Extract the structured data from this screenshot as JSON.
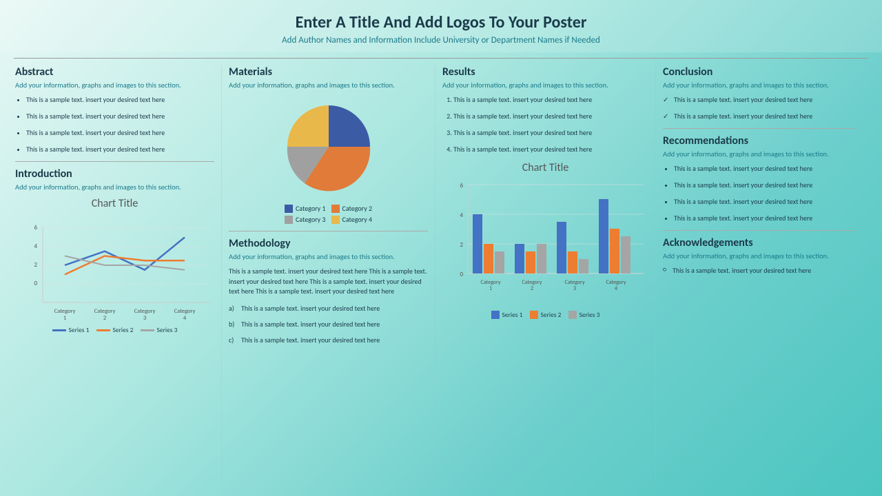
{
  "header": {
    "title": "Enter A Title And Add Logos To Your Poster",
    "subtitle": "Add Author Names and Information Include University or Department Names if Needed"
  },
  "colors": {
    "blue": "#3B5BA5",
    "orange": "#E07B39",
    "gray": "#A0A0A0",
    "yellow": "#E8B84B",
    "teal": "#1a7a8a",
    "dark": "#1a3a4a",
    "series1": "#4472C4",
    "series2": "#ED7D31",
    "series3": "#A5A5A5"
  },
  "abstract": {
    "title": "Abstract",
    "subtitle": "Add your information, graphs and images to this section.",
    "items": [
      "This is a sample text. insert your desired text here",
      "This is a sample text. insert your desired text here",
      "This is a sample text. insert your desired text here",
      "This is a sample text. insert your desired text here"
    ]
  },
  "introduction": {
    "title": "Introduction",
    "subtitle": "Add your information, graphs and images to this section.",
    "chart_title": "Chart Title",
    "categories": [
      "Category 1",
      "Category 2",
      "Category 3",
      "Category 4"
    ],
    "series": [
      "Series 1",
      "Series 2",
      "Series 3"
    ],
    "line_data": {
      "series1": [
        2,
        3.5,
        1.5,
        5
      ],
      "series2": [
        1,
        3,
        2.5,
        2.5
      ],
      "series3": [
        3,
        2,
        2,
        1.5
      ]
    },
    "y_max": 6
  },
  "materials": {
    "title": "Materials",
    "subtitle": "Add your information, graphs and images to this section.",
    "pie_data": [
      {
        "label": "Category 1",
        "value": 25,
        "color": "#3B5BA5"
      },
      {
        "label": "Category 2",
        "value": 30,
        "color": "#E07B39"
      },
      {
        "label": "Category 3",
        "value": 20,
        "color": "#A0A0A0"
      },
      {
        "label": "Category 4",
        "value": 25,
        "color": "#E8B84B"
      }
    ]
  },
  "methodology": {
    "title": "Methodology",
    "subtitle": "Add your information, graphs and images to this section.",
    "body_text": "This is a sample text. insert your desired text here This is a sample text. insert your desired text here This is a sample text. insert your desired text here This is a sample text. insert your desired text here",
    "items": [
      "This is a sample text. insert your desired text here",
      "This is a sample text. insert your desired text here",
      "This is a sample text. insert your desired text here"
    ]
  },
  "results": {
    "title": "Results",
    "subtitle": "Add your information, graphs and images to this section.",
    "items": [
      "This is a sample text. insert your desired text here",
      "This is a sample text. insert your desired text here",
      "This is a sample text. insert your desired text here",
      "This is a sample text. insert your desired text here"
    ],
    "chart_title": "Chart Title",
    "categories": [
      "Category 1",
      "Category 2",
      "Category 3",
      "Category 4"
    ],
    "series": [
      "Series 1",
      "Series 2",
      "Series 3"
    ],
    "bar_data": {
      "series1": [
        4,
        2,
        3.5,
        5
      ],
      "series2": [
        2,
        1.5,
        1.5,
        3
      ],
      "series3": [
        1.5,
        2,
        1,
        2.5
      ]
    },
    "y_max": 6
  },
  "conclusion": {
    "title": "Conclusion",
    "subtitle": "Add your information, graphs and images to this section.",
    "items": [
      "This is a sample text. insert your desired text here",
      "This is a sample text. insert your desired text here"
    ]
  },
  "recommendations": {
    "title": "Recommendations",
    "subtitle": "Add your information, graphs and images to this section.",
    "items": [
      "This is a sample text. insert your desired text here",
      "This is a sample text. insert your desired text here",
      "This is a sample text. insert your desired text here",
      "This is a sample text. insert your desired text here"
    ]
  },
  "acknowledgements": {
    "title": "Acknowledgements",
    "subtitle": "Add your information, graphs and images to this section.",
    "items": [
      "This is a sample text. insert your desired text here"
    ]
  }
}
